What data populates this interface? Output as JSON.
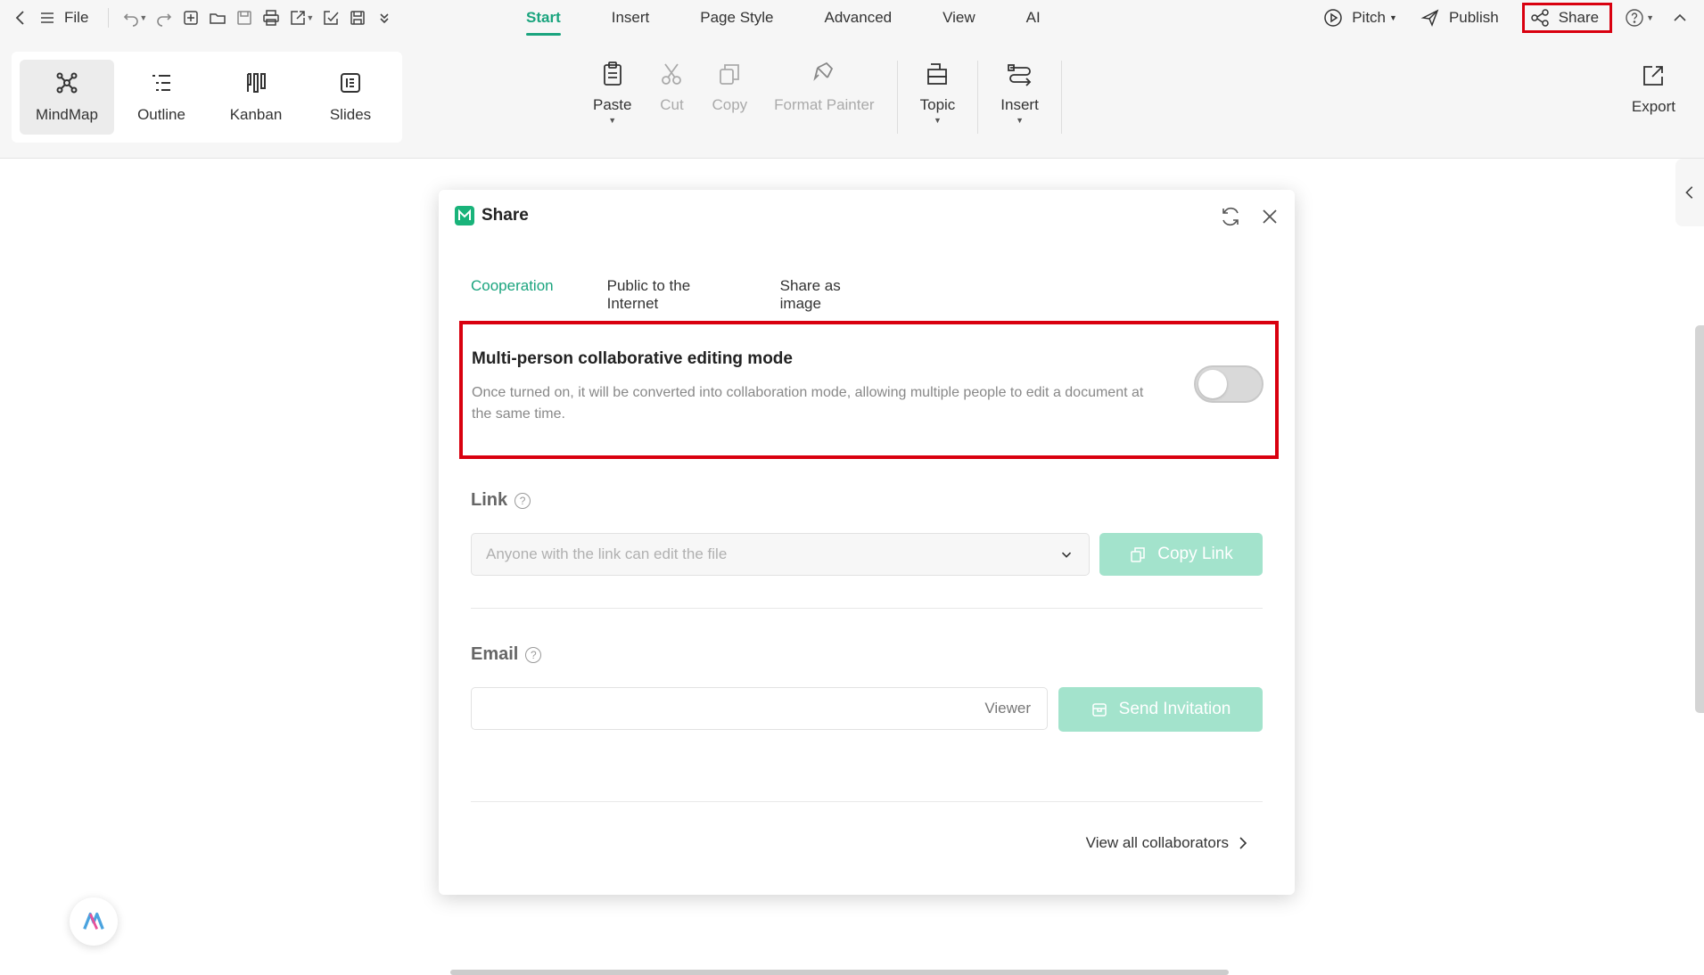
{
  "topbar": {
    "file_label": "File",
    "tabs": [
      {
        "label": "Start",
        "active": true
      },
      {
        "label": "Insert"
      },
      {
        "label": "Page Style"
      },
      {
        "label": "Advanced"
      },
      {
        "label": "View"
      },
      {
        "label": "AI"
      }
    ],
    "pitch_label": "Pitch",
    "publish_label": "Publish",
    "share_label": "Share"
  },
  "ribbon": {
    "views": [
      {
        "label": "MindMap",
        "icon": "mindmap-icon",
        "active": true
      },
      {
        "label": "Outline",
        "icon": "outline-icon"
      },
      {
        "label": "Kanban",
        "icon": "kanban-icon"
      },
      {
        "label": "Slides",
        "icon": "slides-icon"
      }
    ],
    "paste_label": "Paste",
    "cut_label": "Cut",
    "copy_label": "Copy",
    "format_painter_label": "Format Painter",
    "topic_label": "Topic",
    "insert_label": "Insert",
    "export_label": "Export"
  },
  "dialog": {
    "title": "Share",
    "tabs": [
      "Cooperation",
      "Public to the Internet",
      "Share as image"
    ],
    "active_tab": "Cooperation",
    "collab": {
      "title": "Multi-person collaborative editing mode",
      "description": "Once turned on, it will be converted into collaboration mode, allowing multiple people to edit a document at the same time.",
      "enabled": false
    },
    "link": {
      "label": "Link",
      "help": "?",
      "select_value": "Anyone with the link can edit the file",
      "copy_button": "Copy Link"
    },
    "email": {
      "label": "Email",
      "help": "?",
      "input_value": "",
      "role": "Viewer",
      "send_button": "Send Invitation"
    },
    "view_all": "View all collaborators"
  },
  "colors": {
    "accent": "#1aa47e",
    "accent_disabled": "#a3e3cc",
    "highlight": "#d9000f"
  }
}
